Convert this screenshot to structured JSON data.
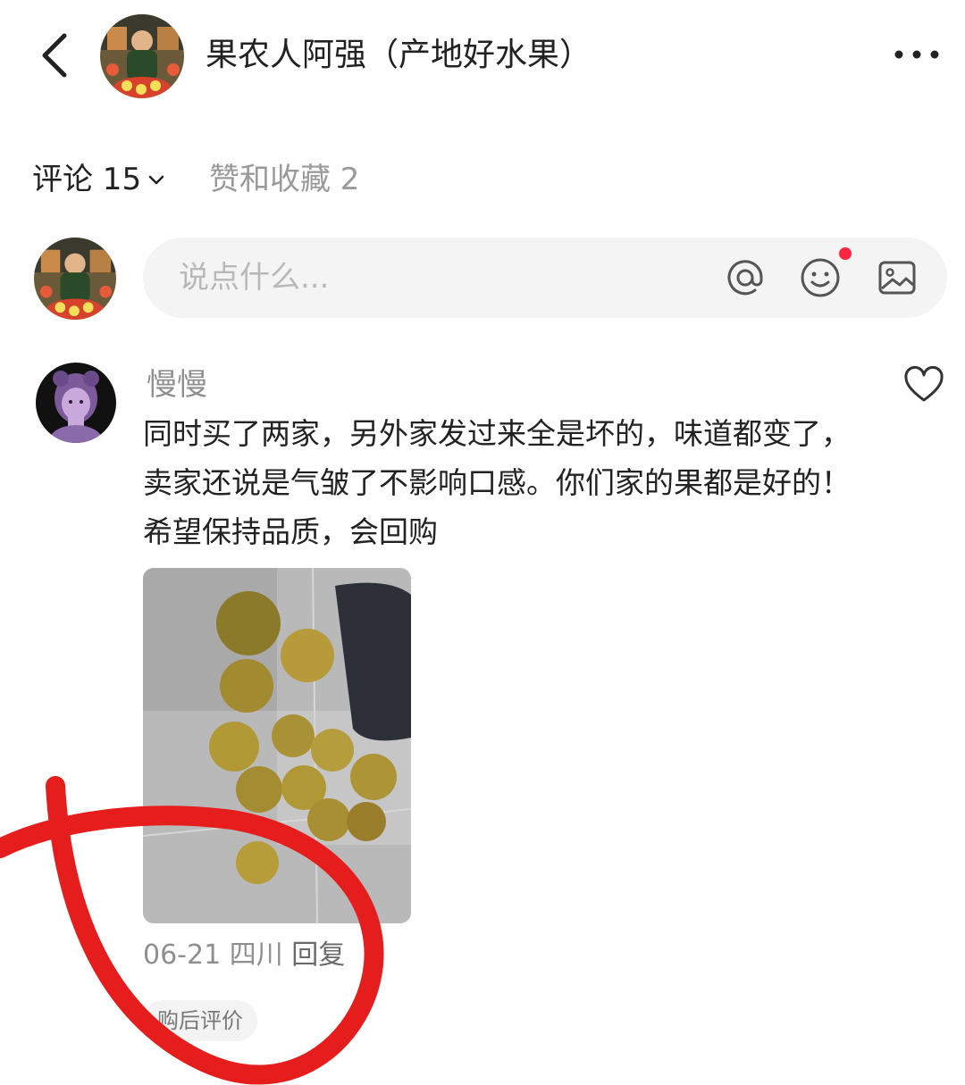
{
  "header": {
    "title": "果农人阿强（产地好水果）"
  },
  "tabs": {
    "comments_label": "评论 15",
    "likes_label": "赞和收藏 2"
  },
  "composer": {
    "placeholder": "说点什么..."
  },
  "comment": {
    "username": "慢慢",
    "text": "同时买了两家，另外家发过来全是坏的，味道都变了，卖家还说是气皱了不影响口感。你们家的果都是好的！希望保持品质，会回购",
    "date": "06-21",
    "location": "四川",
    "reply_label": "回复",
    "tag": "购后评价"
  },
  "colors": {
    "notification_dot": "#ff2442",
    "annotation_circle": "#e51d1d"
  },
  "icons": [
    "back-icon",
    "more-icon",
    "chevron-down-icon",
    "at-icon",
    "emoji-icon",
    "image-icon",
    "heart-icon"
  ]
}
